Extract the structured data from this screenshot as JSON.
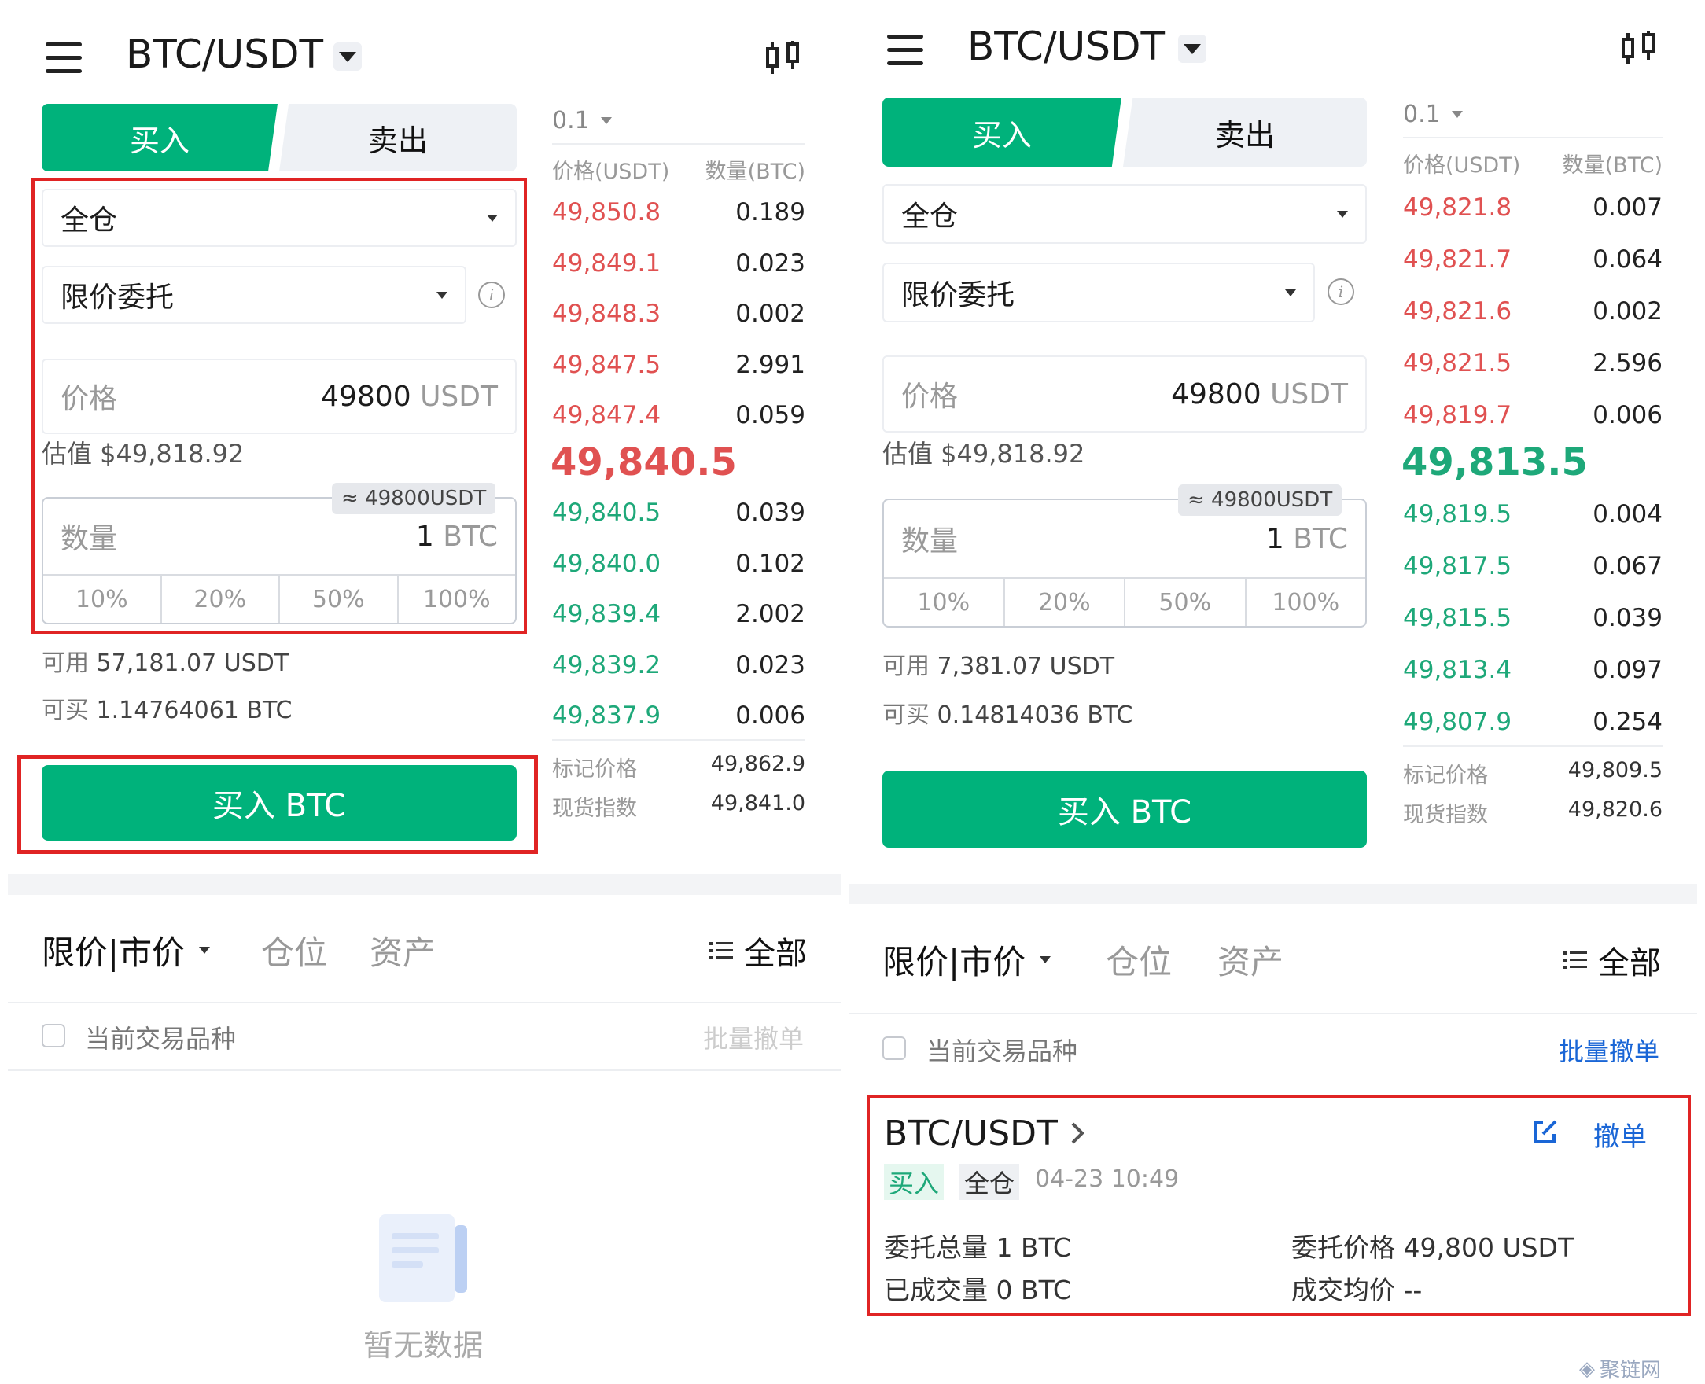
{
  "left": {
    "pair": "BTC/USDT",
    "tabs": {
      "buy": "买入",
      "sell": "卖出"
    },
    "margin_mode": "全仓",
    "order_type": "限价委托",
    "price_field": {
      "label": "价格",
      "value": "49800",
      "unit": "USDT"
    },
    "estimate": "估值 $49,818.92",
    "qty_badge": "≈ 49800USDT",
    "qty_field": {
      "label": "数量",
      "value": "1",
      "unit": "BTC"
    },
    "percent_options": [
      "10%",
      "20%",
      "50%",
      "100%"
    ],
    "available": {
      "label": "可用",
      "value": "57,181.07 USDT"
    },
    "can_buy": {
      "label": "可买",
      "value": "1.14764061 BTC"
    },
    "submit_label": "买入 BTC",
    "orderbook": {
      "precision": "0.1",
      "header_price": "价格(USDT)",
      "header_qty": "数量(BTC)",
      "asks": [
        {
          "price": "49,850.8",
          "qty": "0.189"
        },
        {
          "price": "49,849.1",
          "qty": "0.023"
        },
        {
          "price": "49,848.3",
          "qty": "0.002"
        },
        {
          "price": "49,847.5",
          "qty": "2.991"
        },
        {
          "price": "49,847.4",
          "qty": "0.059"
        }
      ],
      "last_price": "49,840.5",
      "bids": [
        {
          "price": "49,840.5",
          "qty": "0.039"
        },
        {
          "price": "49,840.0",
          "qty": "0.102"
        },
        {
          "price": "49,839.4",
          "qty": "2.002"
        },
        {
          "price": "49,839.2",
          "qty": "0.023"
        },
        {
          "price": "49,837.9",
          "qty": "0.006"
        }
      ],
      "mark_label": "标记价格",
      "mark_value": "49,862.9",
      "index_label": "现货指数",
      "index_value": "49,841.0"
    },
    "bottom_tabs": {
      "orders": "限价|市价",
      "positions": "仓位",
      "assets": "资产",
      "all": "全部"
    },
    "filter_label": "当前交易品种",
    "batch_cancel": "批量撤单",
    "empty_text": "暂无数据"
  },
  "right": {
    "pair": "BTC/USDT",
    "tabs": {
      "buy": "买入",
      "sell": "卖出"
    },
    "margin_mode": "全仓",
    "order_type": "限价委托",
    "price_field": {
      "label": "价格",
      "value": "49800",
      "unit": "USDT"
    },
    "estimate": "估值 $49,818.92",
    "qty_badge": "≈ 49800USDT",
    "qty_field": {
      "label": "数量",
      "value": "1",
      "unit": "BTC"
    },
    "percent_options": [
      "10%",
      "20%",
      "50%",
      "100%"
    ],
    "available": {
      "label": "可用",
      "value": "7,381.07 USDT"
    },
    "can_buy": {
      "label": "可买",
      "value": "0.14814036 BTC"
    },
    "submit_label": "买入 BTC",
    "orderbook": {
      "precision": "0.1",
      "header_price": "价格(USDT)",
      "header_qty": "数量(BTC)",
      "asks": [
        {
          "price": "49,821.8",
          "qty": "0.007"
        },
        {
          "price": "49,821.7",
          "qty": "0.064"
        },
        {
          "price": "49,821.6",
          "qty": "0.002"
        },
        {
          "price": "49,821.5",
          "qty": "2.596"
        },
        {
          "price": "49,819.7",
          "qty": "0.006"
        }
      ],
      "last_price": "49,813.5",
      "bids": [
        {
          "price": "49,819.5",
          "qty": "0.004"
        },
        {
          "price": "49,817.5",
          "qty": "0.067"
        },
        {
          "price": "49,815.5",
          "qty": "0.039"
        },
        {
          "price": "49,813.4",
          "qty": "0.097"
        },
        {
          "price": "49,807.9",
          "qty": "0.254"
        }
      ],
      "mark_label": "标记价格",
      "mark_value": "49,809.5",
      "index_label": "现货指数",
      "index_value": "49,820.6"
    },
    "bottom_tabs": {
      "orders": "限价|市价",
      "positions": "仓位",
      "assets": "资产",
      "all": "全部"
    },
    "filter_label": "当前交易品种",
    "batch_cancel": "批量撤单",
    "order": {
      "pair": "BTC/USDT",
      "cancel": "撤单",
      "side_tag": "买入",
      "mode_tag": "全仓",
      "time": "04-23 10:49",
      "total_label": "委托总量",
      "total_value": "1 BTC",
      "price_label": "委托价格",
      "price_value": "49,800 USDT",
      "filled_label": "已成交量",
      "filled_value": "0 BTC",
      "avg_label": "成交均价",
      "avg_value": "--"
    }
  },
  "watermark": "聚链网",
  "colors": {
    "brand_green": "#00b27b",
    "ask_red": "#e05151",
    "bid_green": "#1ea879",
    "highlight_red": "#e02424",
    "link_blue": "#1a66d6"
  }
}
